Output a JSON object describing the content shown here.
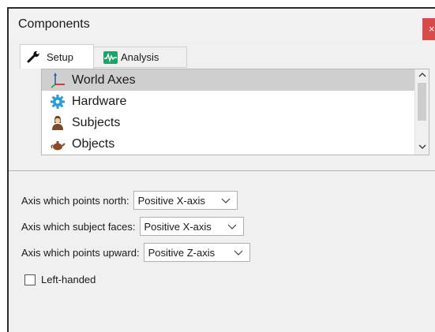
{
  "window": {
    "title": "Components",
    "close_label": "×"
  },
  "tabs": [
    {
      "label": "Setup",
      "icon": "wrench-icon",
      "active": true
    },
    {
      "label": "Analysis",
      "icon": "waveform-icon",
      "active": false
    }
  ],
  "tree": {
    "items": [
      {
        "label": "World Axes",
        "icon": "axes-icon",
        "selected": true
      },
      {
        "label": "Hardware",
        "icon": "gear-icon",
        "selected": false
      },
      {
        "label": "Subjects",
        "icon": "person-icon",
        "selected": false
      },
      {
        "label": "Objects",
        "icon": "teapot-icon",
        "selected": false
      }
    ]
  },
  "settings": {
    "north_label": "Axis which points north:",
    "north_value": "Positive X-axis",
    "faces_label": "Axis which subject faces:",
    "faces_value": "Positive X-axis",
    "upward_label": "Axis which points upward:",
    "upward_value": "Positive Z-axis",
    "left_handed_label": "Left-handed",
    "left_handed_checked": false
  },
  "colors": {
    "close_button": "#d94b4b",
    "selection": "#cfcfcf",
    "analysis_icon": "#1aa36b"
  }
}
